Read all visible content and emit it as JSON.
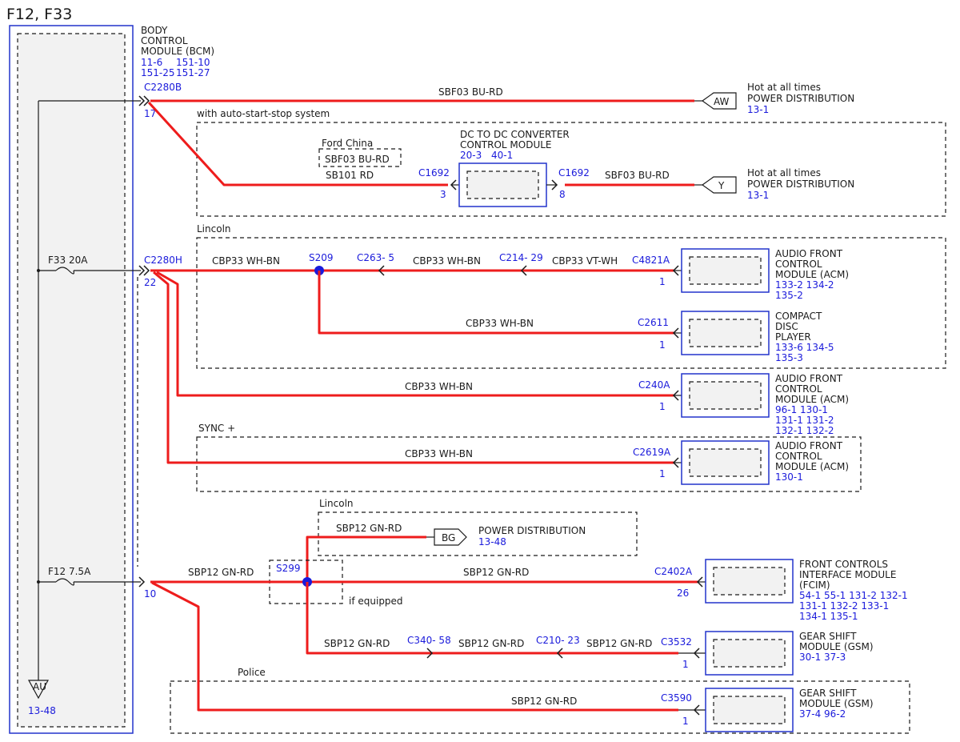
{
  "title": "F12, F33",
  "colors": {
    "wire": "#ee1c1c",
    "connector_text": "#1a1adb",
    "module_border": "#2233cc"
  },
  "bcm": {
    "name": [
      "BODY",
      "CONTROL",
      "MODULE (BCM)"
    ],
    "refs": [
      "11-6",
      "151-10",
      "151-25",
      "151-27"
    ],
    "ground_label": "AU",
    "ground_ref": "13-48"
  },
  "fuses": {
    "f33": "F33  20A",
    "f12": "F12  7.5A"
  },
  "connectors": {
    "c2280b": "C2280B",
    "c2280b_pin": "17",
    "c2280h": "C2280H",
    "c2280h_pin": "22",
    "f12_pin": "10",
    "c1692_left": "C1692",
    "c1692_left_pin": "3",
    "c1692_right": "C1692",
    "c1692_right_pin": "8",
    "s209": "S209",
    "c263": "C263- 5",
    "c214": "C214- 29",
    "c4821a": "C4821A",
    "c4821a_pin": "1",
    "c2611": "C2611",
    "c2611_pin": "1",
    "c240a": "C240A",
    "c240a_pin": "1",
    "c2619a": "C2619A",
    "c2619a_pin": "1",
    "s299": "S299",
    "c2402a": "C2402A",
    "c2402a_pin": "26",
    "c340": "C340- 58",
    "c210": "C210- 23",
    "c3532": "C3532",
    "c3532_pin": "1",
    "c3590": "C3590",
    "c3590_pin": "1"
  },
  "wires": {
    "sbf03_bu_rd": "SBF03  BU-RD",
    "sb101_rd": "SB101  RD",
    "cbp33_wh_bn": "CBP33  WH-BN",
    "cbp33_vt_wh": "CBP33  VT-WH",
    "sbp12_gn_rd": "SBP12  GN-RD"
  },
  "groups": {
    "auto_start_stop": "with auto-start-stop system",
    "ford_china": "Ford China",
    "lincoln_1": "Lincoln",
    "sync_plus": "SYNC +",
    "lincoln_2": "Lincoln",
    "if_equipped": "if equipped",
    "police": "Police"
  },
  "terminals": {
    "aw": {
      "tag": "AW",
      "lines": [
        "Hot at all times",
        "POWER DISTRIBUTION"
      ],
      "ref": "13-1"
    },
    "y": {
      "tag": "Y",
      "lines": [
        "Hot at all times",
        "POWER DISTRIBUTION"
      ],
      "ref": "13-1"
    },
    "bg": {
      "tag": "BG",
      "lines": [
        "POWER DISTRIBUTION"
      ],
      "ref": "13-48"
    }
  },
  "modules": {
    "dcdc": {
      "lines": [
        "DC TO DC CONVERTER",
        "CONTROL MODULE"
      ],
      "refs": [
        "20-3",
        "40-1"
      ]
    },
    "acm1": {
      "lines": [
        "AUDIO FRONT",
        "CONTROL",
        "MODULE (ACM)"
      ],
      "refs": [
        "133-2 134-2",
        "135-2"
      ]
    },
    "cdp": {
      "lines": [
        "COMPACT",
        "DISC",
        "PLAYER"
      ],
      "refs": [
        "133-6 134-5",
        "135-3"
      ]
    },
    "acm2": {
      "lines": [
        "AUDIO FRONT",
        "CONTROL",
        "MODULE (ACM)"
      ],
      "refs": [
        "96-1   130-1",
        "131-1 131-2",
        "132-1 132-2"
      ]
    },
    "acm3": {
      "lines": [
        "AUDIO FRONT",
        "CONTROL",
        "MODULE (ACM)"
      ],
      "refs": [
        "130-1"
      ]
    },
    "fcim": {
      "lines": [
        "FRONT CONTROLS",
        "INTERFACE MODULE",
        "(FCIM)"
      ],
      "refs": [
        "54-1   55-1   131-2 132-1",
        "131-1 132-2 133-1",
        "134-1 135-1"
      ]
    },
    "gsm1": {
      "lines": [
        "GEAR SHIFT",
        "MODULE (GSM)"
      ],
      "refs": [
        "30-1   37-3"
      ]
    },
    "gsm2": {
      "lines": [
        "GEAR SHIFT",
        "MODULE (GSM)"
      ],
      "refs": [
        "37-4   96-2"
      ]
    }
  }
}
